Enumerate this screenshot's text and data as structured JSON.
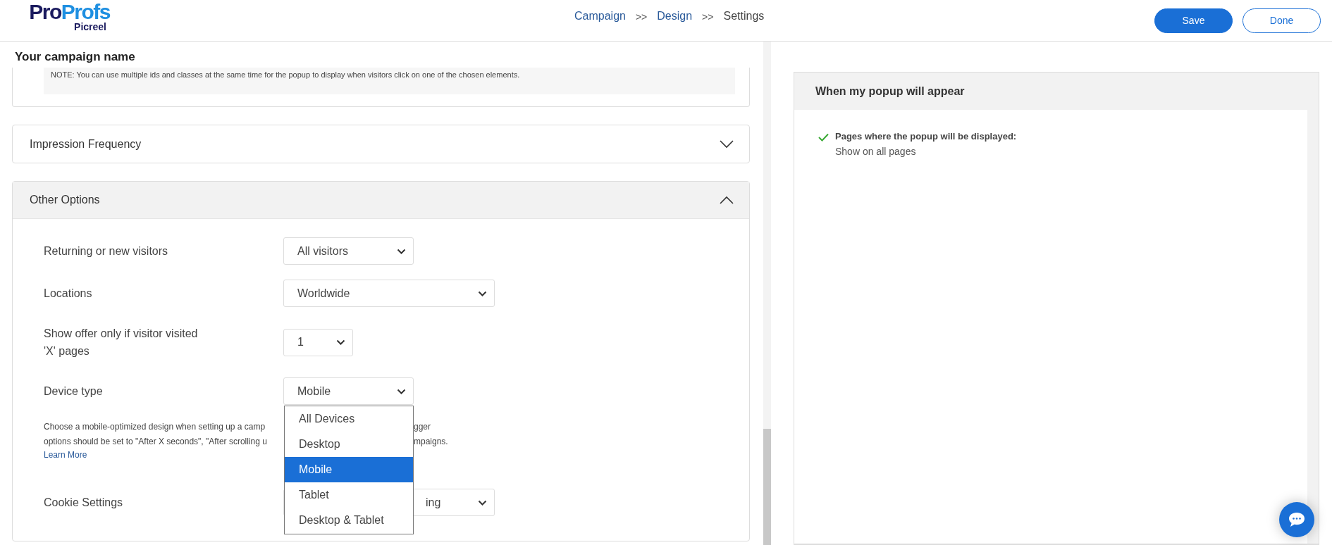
{
  "header": {
    "logo": {
      "brand": "ProProfs",
      "product": "Picreel"
    },
    "breadcrumb": [
      {
        "kind": "step",
        "label": "Campaign",
        "current": false
      },
      {
        "kind": "separator",
        "label": ">>"
      },
      {
        "kind": "step",
        "label": "Design",
        "current": false
      },
      {
        "kind": "separator",
        "label": ">>"
      },
      {
        "kind": "step",
        "label": "Settings",
        "current": true
      }
    ],
    "buttons": [
      {
        "kind": "primary",
        "label": "Save"
      },
      {
        "kind": "outline",
        "label": "Done"
      }
    ]
  },
  "campaign_name": "Your campaign name",
  "sections": [
    {
      "kind": "note",
      "text": "NOTE: You can use multiple ids and classes at the same time for the popup to display when visitors click on one of the chosen elements."
    },
    {
      "kind": "accordion",
      "title": "Impression Frequency",
      "expanded": false
    },
    {
      "kind": "accordion",
      "title": "Other Options",
      "expanded": true,
      "fields": [
        {
          "label": "Returning or new visitors",
          "value": "All visitors"
        },
        {
          "label": "Locations",
          "value": "Worldwide"
        },
        {
          "label": "Show offer only if visitor visited 'X' pages",
          "value": "1"
        },
        {
          "label": "Device type",
          "value": "Mobile",
          "options": [
            {
              "label": "All Devices",
              "selected": false
            },
            {
              "label": "Desktop",
              "selected": false
            },
            {
              "label": "Mobile",
              "selected": true
            },
            {
              "label": "Tablet",
              "selected": false
            },
            {
              "label": "Desktop & Tablet",
              "selected": false
            }
          ],
          "help": {
            "lines": [
              [
                "Choose a mobile-optimized design when setting up a camp",
                "gger"
              ],
              [
                "options should be set to \"After X seconds\", \"After scrolling u",
                "mpaigns."
              ]
            ],
            "link": "Learn More"
          }
        },
        {
          "label": "Cookie Settings",
          "value": "ing"
        }
      ]
    }
  ],
  "summary": {
    "title": "When my popup will appear",
    "items": [
      {
        "checked": true,
        "title": "Pages where the popup will be displayed:",
        "value": "Show on all pages"
      }
    ]
  }
}
